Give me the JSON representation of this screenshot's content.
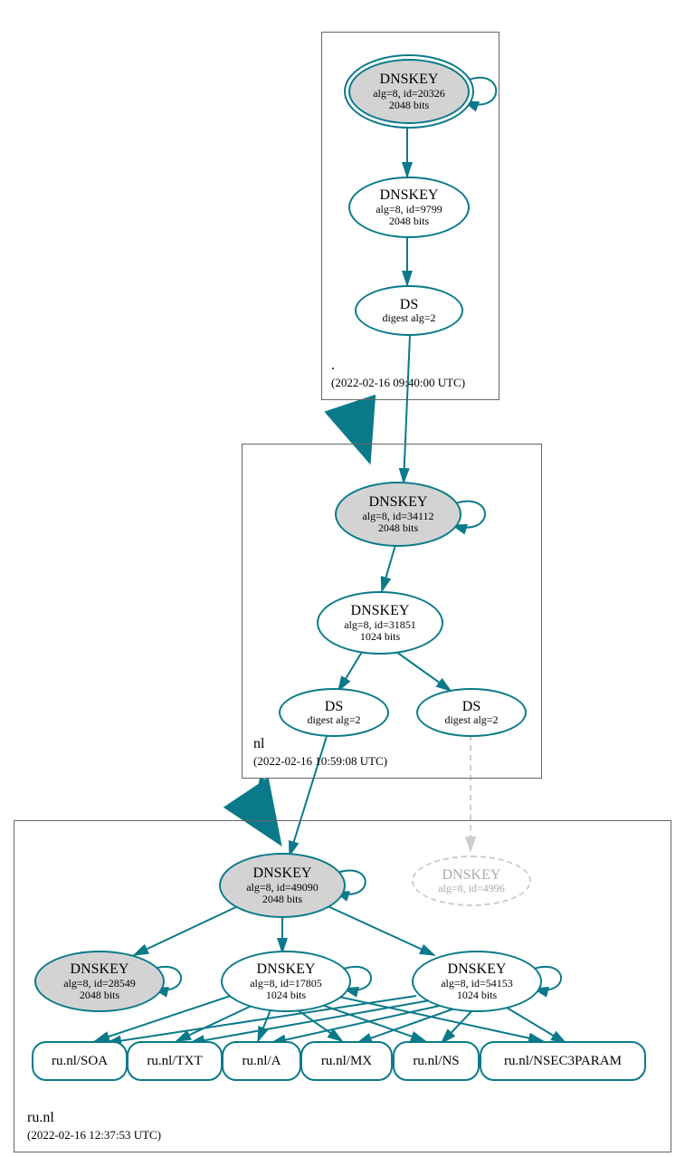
{
  "zones": {
    "root": {
      "label": ".",
      "timestamp": "(2022-02-16 09:40:00 UTC)",
      "nodes": {
        "dnskey1": {
          "title": "DNSKEY",
          "sub1": "alg=8, id=20326",
          "sub2": "2048 bits"
        },
        "dnskey2": {
          "title": "DNSKEY",
          "sub1": "alg=8, id=9799",
          "sub2": "2048 bits"
        },
        "ds1": {
          "title": "DS",
          "sub1": "digest alg=2"
        }
      }
    },
    "nl": {
      "label": "nl",
      "timestamp": "(2022-02-16 10:59:08 UTC)",
      "nodes": {
        "dnskey1": {
          "title": "DNSKEY",
          "sub1": "alg=8, id=34112",
          "sub2": "2048 bits"
        },
        "dnskey2": {
          "title": "DNSKEY",
          "sub1": "alg=8, id=31851",
          "sub2": "1024 bits"
        },
        "ds1": {
          "title": "DS",
          "sub1": "digest alg=2"
        },
        "ds2": {
          "title": "DS",
          "sub1": "digest alg=2"
        }
      }
    },
    "runl": {
      "label": "ru.nl",
      "timestamp": "(2022-02-16 12:37:53 UTC)",
      "nodes": {
        "dnskey1": {
          "title": "DNSKEY",
          "sub1": "alg=8, id=49090",
          "sub2": "2048 bits"
        },
        "dnskey_dashed": {
          "title": "DNSKEY",
          "sub1": "alg=8, id=4996"
        },
        "dnskey2": {
          "title": "DNSKEY",
          "sub1": "alg=8, id=28549",
          "sub2": "2048 bits"
        },
        "dnskey3": {
          "title": "DNSKEY",
          "sub1": "alg=8, id=17805",
          "sub2": "1024 bits"
        },
        "dnskey4": {
          "title": "DNSKEY",
          "sub1": "alg=8, id=54153",
          "sub2": "1024 bits"
        }
      },
      "records": {
        "soa": "ru.nl/SOA",
        "txt": "ru.nl/TXT",
        "a": "ru.nl/A",
        "mx": "ru.nl/MX",
        "ns": "ru.nl/NS",
        "nsec3": "ru.nl/NSEC3PARAM"
      }
    }
  }
}
